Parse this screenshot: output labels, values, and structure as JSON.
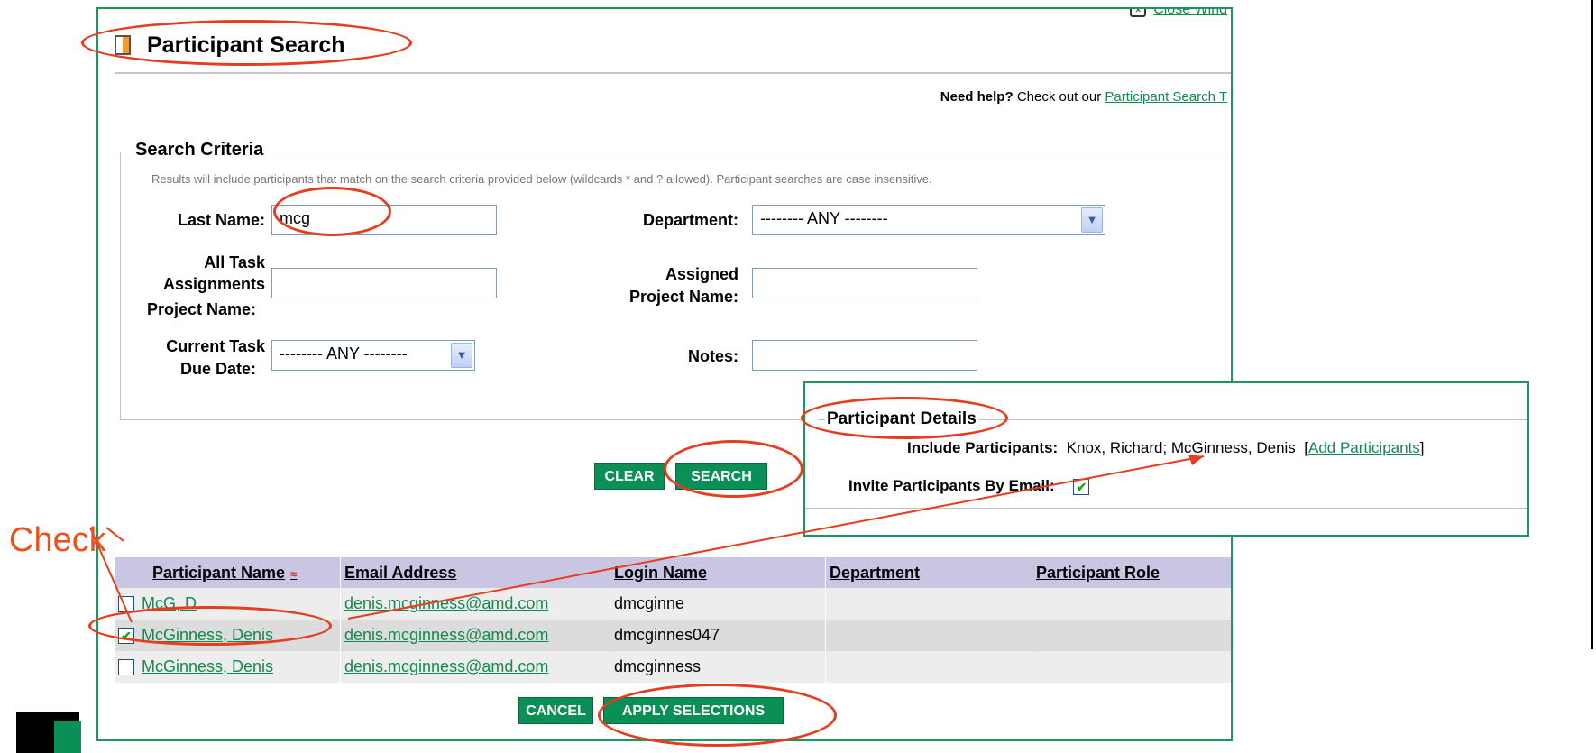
{
  "window": {
    "close_label": "Close Wind"
  },
  "header": {
    "title": "Participant Search"
  },
  "help": {
    "prefix": "Need help?",
    "middle": "Check out our",
    "link": "Participant Search T"
  },
  "criteria": {
    "legend": "Search Criteria",
    "note": "Results will include participants that match on the search criteria provided below (wildcards * and ? allowed). Participant searches are case insensitive.",
    "last_name_label": "Last Name:",
    "last_name_value": "mcg",
    "department_label": "Department:",
    "department_value": "-------- ANY --------",
    "all_task_label_1": "All Task",
    "all_task_label_2": "Assignments",
    "all_task_label_3": "Project Name:",
    "all_task_value": "",
    "assigned_label_1": "Assigned",
    "assigned_label_2": "Project Name:",
    "assigned_value": "",
    "due_label_1": "Current Task",
    "due_label_2": "Due Date:",
    "due_value": "-------- ANY --------",
    "notes_label": "Notes:",
    "notes_value": ""
  },
  "buttons": {
    "clear": "CLEAR",
    "search": "SEARCH",
    "cancel": "CANCEL",
    "apply": "APPLY SELECTIONS"
  },
  "table": {
    "headers": [
      "Participant Name",
      "Email Address",
      "Login Name",
      "Department",
      "Participant Role"
    ],
    "rows": [
      {
        "checked": false,
        "name": "McG, D",
        "email": "denis.mcginness@amd.com",
        "login": "dmcginne",
        "department": "",
        "role": ""
      },
      {
        "checked": true,
        "name": "McGinness, Denis",
        "email": "denis.mcginness@amd.com",
        "login": "dmcginnes047",
        "department": "",
        "role": ""
      },
      {
        "checked": false,
        "name": "McGinness, Denis",
        "email": "denis.mcginness@amd.com",
        "login": "dmcginness",
        "department": "",
        "role": ""
      }
    ]
  },
  "details": {
    "title": "Participant Details",
    "include_label": "Include Participants:",
    "include_value": "Knox, Richard; McGinness, Denis",
    "add_link": "Add Participants",
    "bracket_open": "[",
    "bracket_close": "]",
    "invite_label": "Invite Participants By Email:",
    "invite_checked": true
  },
  "annotation": {
    "check_label": "Check"
  },
  "icons": {
    "title": "page-icon",
    "close": "close-box-icon",
    "sort": "sort-ascending-icon",
    "dropdown": "chevron-down-icon",
    "checkmark": "checkmark-icon"
  },
  "colors": {
    "accent": "#0a8f56",
    "border": "#1a9a5a",
    "header_bg": "#c9c6e4",
    "annotation": "#e63d1e",
    "label_text": "#e8541c"
  }
}
